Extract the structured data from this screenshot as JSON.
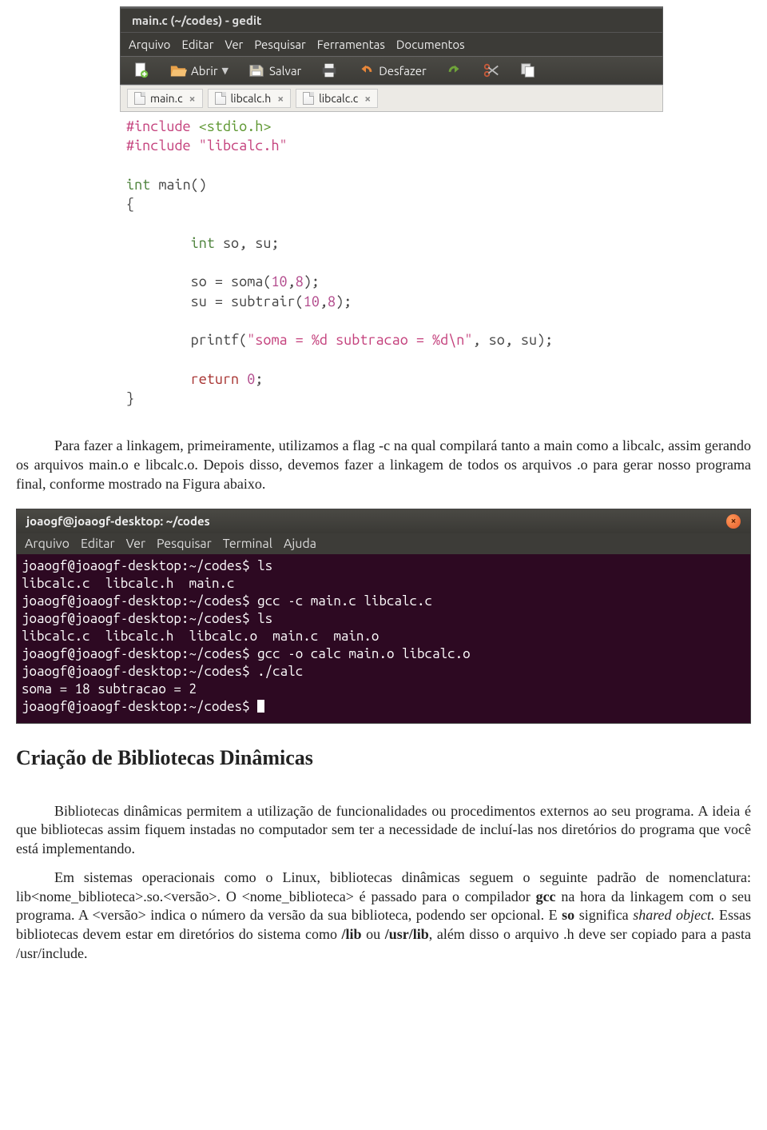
{
  "gedit": {
    "title": "main.c (~/codes) - gedit",
    "menu": [
      "Arquivo",
      "Editar",
      "Ver",
      "Pesquisar",
      "Ferramentas",
      "Documentos"
    ],
    "toolbar": {
      "open": "Abrir",
      "save": "Salvar",
      "undo": "Desfazer"
    },
    "tabs": [
      "main.c",
      "libcalc.h",
      "libcalc.c"
    ],
    "code": {
      "l1_inc": "#include",
      "l1_h": " <stdio.h>",
      "l2_inc": "#include",
      "l2_h": " \"libcalc.h\"",
      "l3": "",
      "l4_int": "int",
      "l4_rest": " main()",
      "l5": "{",
      "l6": "",
      "l7_pad": "        ",
      "l7_int": "int",
      "l7_rest": " so, su;",
      "l8": "",
      "l9": "        so = soma(",
      "l9_n1": "10",
      "l9_c": ",",
      "l9_n2": "8",
      "l9_end": ");",
      "l10": "        su = subtrair(",
      "l10_n1": "10",
      "l10_c": ",",
      "l10_n2": "8",
      "l10_end": ");",
      "l11": "",
      "l12": "        printf(",
      "l12_s": "\"soma = %d subtracao = %d\\n\"",
      "l12_rest": ", so, su);",
      "l13": "",
      "l14_pad": "        ",
      "l14_ret": "return",
      "l14_sp": " ",
      "l14_n": "0",
      "l14_end": ";",
      "l15": "}"
    }
  },
  "para1": "Para fazer a linkagem, primeiramente, utilizamos a flag -c na qual compilará tanto a main como a libcalc, assim gerando os arquivos main.o e libcalc.o. Depois disso, devemos fazer a linkagem de todos os arquivos .o para gerar nosso programa final, conforme mostrado na Figura abaixo.",
  "terminal": {
    "title": "joaogf@joaogf-desktop: ~/codes",
    "menu": [
      "Arquivo",
      "Editar",
      "Ver",
      "Pesquisar",
      "Terminal",
      "Ajuda"
    ],
    "lines": [
      "joaogf@joaogf-desktop:~/codes$ ls",
      "libcalc.c  libcalc.h  main.c",
      "joaogf@joaogf-desktop:~/codes$ gcc -c main.c libcalc.c",
      "joaogf@joaogf-desktop:~/codes$ ls",
      "libcalc.c  libcalc.h  libcalc.o  main.c  main.o",
      "joaogf@joaogf-desktop:~/codes$ gcc -o calc main.o libcalc.o",
      "joaogf@joaogf-desktop:~/codes$ ./calc",
      "soma = 18 subtracao = 2",
      "joaogf@joaogf-desktop:~/codes$ "
    ]
  },
  "heading2": "Criação de Bibliotecas Dinâmicas",
  "para2": "Bibliotecas dinâmicas permitem a utilização de funcionalidades ou procedimentos externos ao seu programa. A ideia é que bibliotecas assim fiquem instadas no computador sem ter a necessidade de incluí-las nos diretórios do programa que você está implementando.",
  "para3_parts": {
    "p1": "Em sistemas operacionais como o Linux, bibliotecas dinâmicas seguem o seguinte  padrão de nomenclatura: lib<nome_biblioteca>.so.<versão>. O <nome_biblioteca> é passado para o compilador ",
    "b1": "gcc",
    "p2": " na hora da linkagem com o seu programa. A <versão> indica o número da versão da sua biblioteca, podendo ser opcional. E ",
    "b2": "so",
    "p3": " significa ",
    "i1": "shared object.",
    "p4": " Essas bibliotecas devem estar em diretórios do sistema como ",
    "b3": "/lib",
    "p5": " ou ",
    "b4": "/usr/lib",
    "p6": ", além disso o arquivo .h deve ser copiado para a pasta /usr/include."
  }
}
